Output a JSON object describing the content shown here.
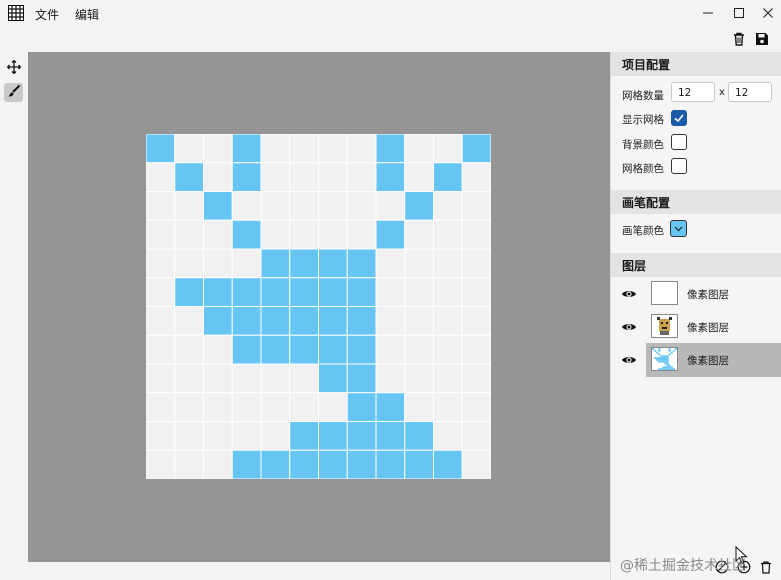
{
  "menubar": {
    "file": "文件",
    "edit": "编辑"
  },
  "panel": {
    "project_header": "项目配置",
    "grid_count_label": "网格数量",
    "grid_cols": "12",
    "grid_x": "x",
    "grid_rows": "12",
    "show_grid_label": "显示网格",
    "show_grid_checked": true,
    "bg_color_label": "背景颜色",
    "grid_color_label": "网格颜色",
    "brush_header": "画笔配置",
    "brush_color_label": "画笔颜色",
    "brush_color": "#66c5f3",
    "layers_header": "图层",
    "layers": [
      {
        "name": "像素图层",
        "selected": false
      },
      {
        "name": "像素图层",
        "selected": false
      },
      {
        "name": "像素图层",
        "selected": true
      }
    ]
  },
  "canvas": {
    "cols": 12,
    "rows": 12,
    "cell_color": "#66c5f3",
    "empty_color": "#f1f1f1",
    "grid_line_color": "#ffffff",
    "workspace_color": "#959595",
    "cells": [
      [
        1,
        0,
        0,
        1,
        0,
        0,
        0,
        0,
        1,
        0,
        0,
        1
      ],
      [
        0,
        1,
        0,
        1,
        0,
        0,
        0,
        0,
        1,
        0,
        1,
        0
      ],
      [
        0,
        0,
        1,
        0,
        0,
        0,
        0,
        0,
        0,
        1,
        0,
        0
      ],
      [
        0,
        0,
        0,
        1,
        0,
        0,
        0,
        0,
        1,
        0,
        0,
        0
      ],
      [
        0,
        0,
        0,
        0,
        1,
        1,
        1,
        1,
        0,
        0,
        0,
        0
      ],
      [
        0,
        1,
        1,
        1,
        1,
        1,
        1,
        1,
        0,
        0,
        0,
        0
      ],
      [
        0,
        0,
        1,
        1,
        1,
        1,
        1,
        1,
        0,
        0,
        0,
        0
      ],
      [
        0,
        0,
        0,
        1,
        1,
        1,
        1,
        1,
        0,
        0,
        0,
        0
      ],
      [
        0,
        0,
        0,
        0,
        0,
        0,
        1,
        1,
        0,
        0,
        0,
        0
      ],
      [
        0,
        0,
        0,
        0,
        0,
        0,
        0,
        1,
        1,
        0,
        0,
        0
      ],
      [
        0,
        0,
        0,
        0,
        0,
        1,
        1,
        1,
        1,
        1,
        0,
        0
      ],
      [
        0,
        0,
        0,
        1,
        1,
        1,
        1,
        1,
        1,
        1,
        1,
        0
      ]
    ]
  },
  "watermark": "@稀土掘金技术社区",
  "icons": {
    "logo": "grid-logo-icon",
    "move": "move-icon",
    "brush": "brush-icon",
    "delete": "trash-icon",
    "save": "save-icon",
    "eye": "eye-icon"
  }
}
